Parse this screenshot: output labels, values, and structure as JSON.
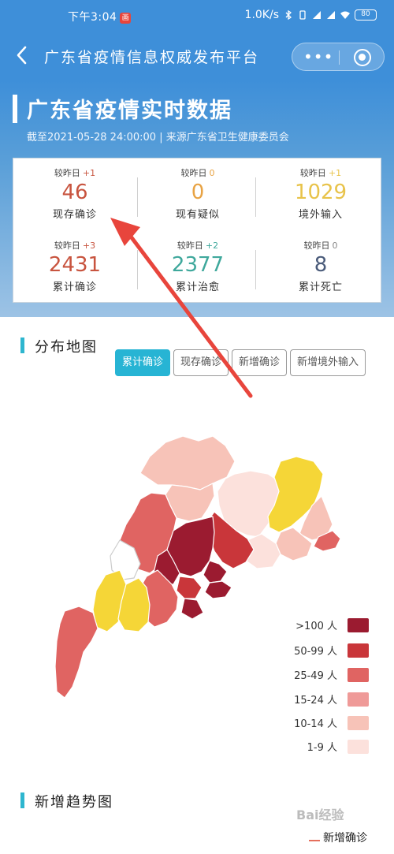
{
  "status_bar": {
    "time": "下午3:04",
    "notification": "画",
    "network_speed": "1.0K/s",
    "battery": "80"
  },
  "titlebar": {
    "back_icon": "chevron-left-icon",
    "title": "广东省疫情信息权威发布平台",
    "more_icon": "more-dots-icon",
    "close_icon": "miniprogram-target-icon"
  },
  "header": {
    "title": "广东省疫情实时数据",
    "subtitle": "截至2021-05-28 24:00:00 | 来源广东省卫生健康委员会"
  },
  "stats": {
    "compare_label": "较昨日",
    "items": [
      {
        "delta": "+1",
        "value": "46",
        "label": "现存确诊",
        "color": "#c8543f",
        "delta_color": "#c8543f"
      },
      {
        "delta": "0",
        "value": "0",
        "label": "现有疑似",
        "color": "#e8a344",
        "delta_color": "#e8a344"
      },
      {
        "delta": "+1",
        "value": "1029",
        "label": "境外输入",
        "color": "#e8c34a",
        "delta_color": "#e8c34a"
      },
      {
        "delta": "+3",
        "value": "2431",
        "label": "累计确诊",
        "color": "#c8543f",
        "delta_color": "#c8543f"
      },
      {
        "delta": "+2",
        "value": "2377",
        "label": "累计治愈",
        "color": "#3fa89c",
        "delta_color": "#3fa89c"
      },
      {
        "delta": "0",
        "value": "8",
        "label": "累计死亡",
        "color": "#4a5b7a",
        "delta_color": "#888888"
      }
    ]
  },
  "map_section": {
    "title": "分布地图",
    "tabs": [
      "累计确诊",
      "现存确诊",
      "新增确诊",
      "新增境外输入"
    ],
    "active_tab": 0,
    "legend": [
      {
        "label": ">100 人",
        "color": "#9b1b30"
      },
      {
        "label": "50-99 人",
        "color": "#c9363a"
      },
      {
        "label": "25-49 人",
        "color": "#e06462"
      },
      {
        "label": "15-24 人",
        "color": "#ef9a98"
      },
      {
        "label": "10-14 人",
        "color": "#f7c3b8"
      },
      {
        "label": "1-9 人",
        "color": "#fce1dc"
      }
    ]
  },
  "trend_section": {
    "title": "新增趋势图",
    "legend_label": "新增确诊",
    "watermark": "Bai经验"
  },
  "colors": {
    "accent": "#3e8fd9",
    "tab_active": "#27b4d4",
    "annotation_arrow": "#e8453c",
    "yellow_region": "#f5d637"
  }
}
